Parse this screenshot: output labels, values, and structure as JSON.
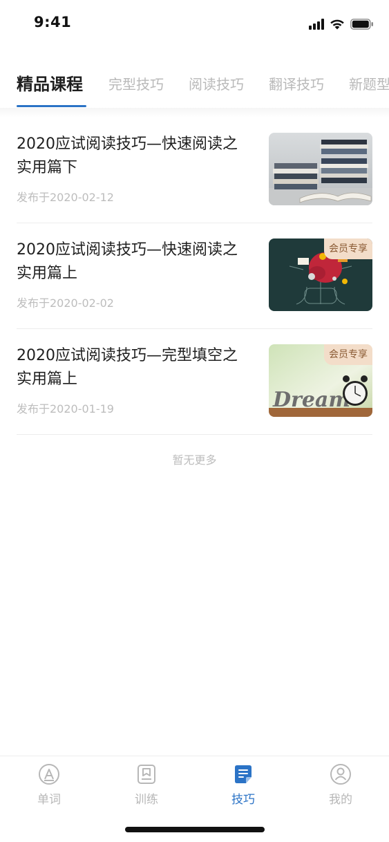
{
  "status_bar": {
    "time": "9:41"
  },
  "tabs": [
    {
      "label": "精品课程",
      "active": true
    },
    {
      "label": "完型技巧",
      "active": false
    },
    {
      "label": "阅读技巧",
      "active": false
    },
    {
      "label": "翻译技巧",
      "active": false
    },
    {
      "label": "新题型",
      "active": false
    }
  ],
  "courses": [
    {
      "title": "2020应试阅读技巧—快速阅读之实用篇下",
      "date": "发布于2020-02-12",
      "thumb": "stacked-books-image",
      "badge": ""
    },
    {
      "title": "2020应试阅读技巧—快速阅读之实用篇上",
      "date": "发布于2020-02-02",
      "thumb": "brainstorm-image",
      "badge": "会员专享"
    },
    {
      "title": "2020应试阅读技巧—完型填空之实用篇上",
      "date": "发布于2020-01-19",
      "thumb": "dream-clock-image",
      "badge": "会员专享"
    }
  ],
  "list_footer": "暂无更多",
  "bottom_nav": [
    {
      "label": "单词",
      "icon": "word-icon",
      "active": false
    },
    {
      "label": "训练",
      "icon": "training-icon",
      "active": false
    },
    {
      "label": "技巧",
      "icon": "tips-icon",
      "active": true
    },
    {
      "label": "我的",
      "icon": "profile-icon",
      "active": false
    }
  ],
  "colors": {
    "accent": "#2b73c6",
    "vip_badge_bg": "#f3ddc9",
    "vip_badge_text": "#8a5a34",
    "inactive": "#b7b7b7"
  }
}
